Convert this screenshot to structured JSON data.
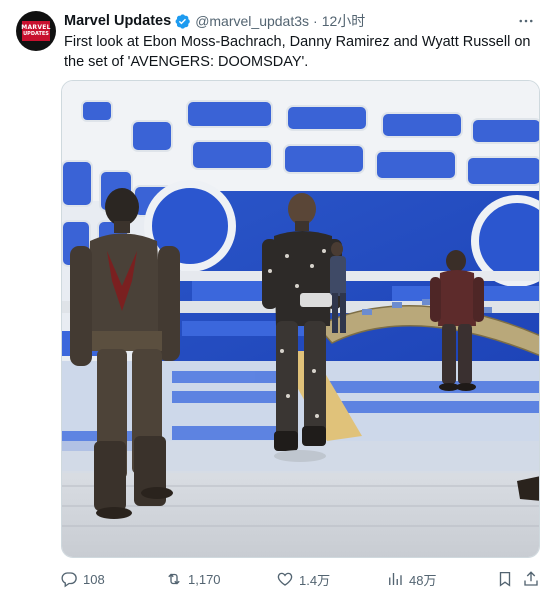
{
  "tweet": {
    "author": {
      "name": "Marvel Updates",
      "handle": "@marvel_updat3s",
      "avatar_text_top": "MARVEL",
      "avatar_text_bottom": "UPDATES",
      "verified": true
    },
    "separator": "·",
    "time": "12小时",
    "text": "First look at Ebon Moss-Bachrach, Danny Ramirez and Wyatt Russell on the set of 'AVENGERS: DOOMSDAY'.",
    "media": {
      "type": "photo",
      "icon": "photo"
    },
    "actions": {
      "replies": "108",
      "reposts": "1,170",
      "likes": "1.4万",
      "views": "48万"
    }
  },
  "icons": {
    "verified": "verified-badge-icon",
    "more": "more-icon",
    "reply": "reply-icon",
    "repost": "repost-icon",
    "like": "heart-icon",
    "views": "views-icon",
    "bookmark": "bookmark-icon",
    "share": "share-icon"
  },
  "colors": {
    "verified_blue": "#1d9bf0",
    "text_primary": "#0f1419",
    "text_secondary": "#536471",
    "avatar_red": "#c8102e"
  }
}
